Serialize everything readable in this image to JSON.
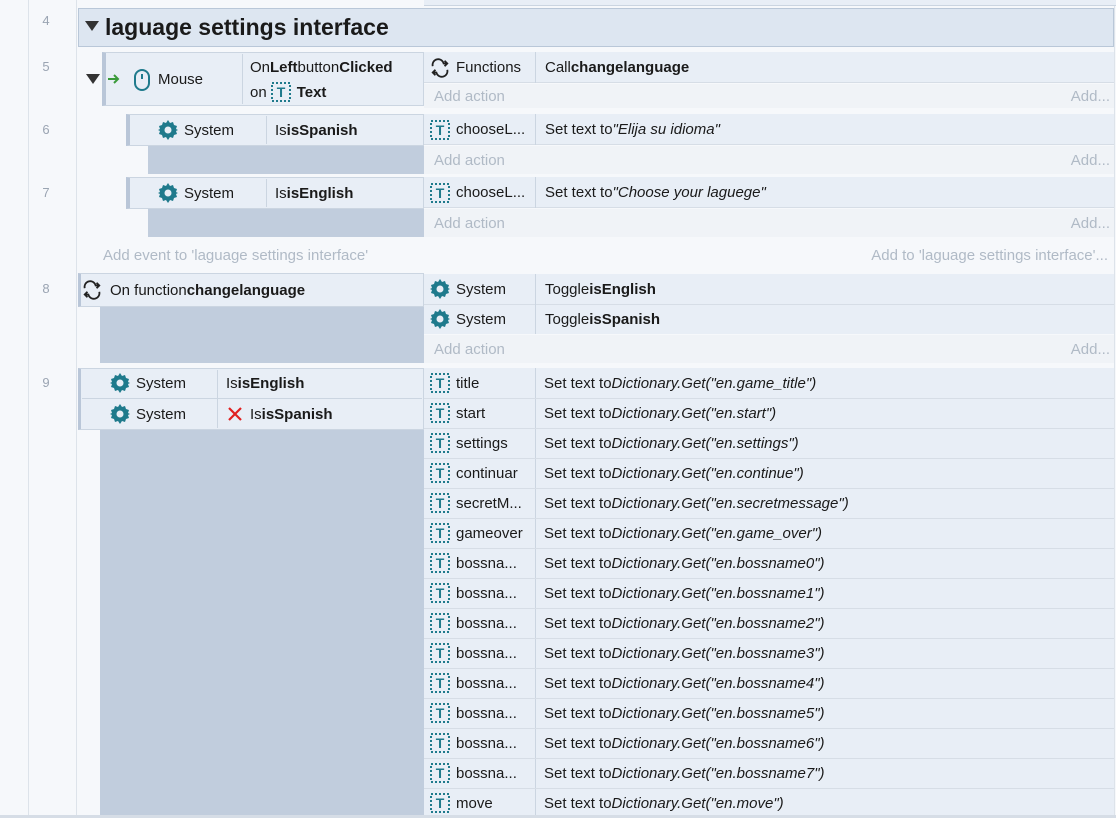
{
  "colors": {
    "teal": "#1f7a8c",
    "gutter": "#c1cddd",
    "cond": "#e8eef6",
    "green": "#3a9a3a",
    "red": "#e02020"
  },
  "line_numbers": [
    "4",
    "5",
    "6",
    "7",
    "8",
    "9"
  ],
  "group": {
    "title": "laguage settings interface",
    "expand_icon": "triangle-down-icon"
  },
  "event5": {
    "object": "Mouse",
    "icon": "mouse-icon",
    "cond_parts": [
      "On ",
      "Left",
      " button ",
      "Clicked"
    ],
    "cond_line2_prefix": "on ",
    "cond_line2_object": "Text",
    "action_object": "Functions",
    "action_text_prefix": "Call ",
    "action_text_bold": "changelanguage",
    "add_action": "Add action",
    "add_more": "Add..."
  },
  "event6": {
    "object": "System",
    "cond_prefix": "Is ",
    "cond_bold": "isSpanish",
    "action_object": "chooseL...",
    "action_prefix": "Set text to ",
    "action_italic": "\"Elija su idioma\"",
    "add_action": "Add action",
    "add_more": "Add..."
  },
  "event7": {
    "object": "System",
    "cond_prefix": "Is ",
    "cond_bold": "isEnglish",
    "action_object": "chooseL...",
    "action_prefix": "Set text to ",
    "action_italic": "\"Choose your laguege\"",
    "add_action": "Add action",
    "add_more": "Add..."
  },
  "group_footer": {
    "add_event": "Add event to 'laguage settings interface'",
    "add_to": "Add to 'laguage settings interface'..."
  },
  "event8": {
    "title_prefix": "On function ",
    "title_bold": "changelanguage",
    "actions": [
      {
        "object": "System",
        "prefix": "Toggle ",
        "bold": "isEnglish"
      },
      {
        "object": "System",
        "prefix": "Toggle ",
        "bold": "isSpanish"
      }
    ],
    "add_action": "Add action",
    "add_more": "Add..."
  },
  "event9": {
    "conditions": [
      {
        "object": "System",
        "prefix": "Is ",
        "bold": "isEnglish",
        "inverted": false
      },
      {
        "object": "System",
        "prefix": "Is ",
        "bold": "isSpanish",
        "inverted": true
      }
    ],
    "actions": [
      {
        "object": "title",
        "prefix": "Set text to ",
        "func": "Dictionary.Get(",
        "arg": "\"en.game_title\"",
        ")": ")"
      },
      {
        "object": "start",
        "prefix": "Set text to ",
        "func": "Dictionary.Get(",
        "arg": "\"en.start\"",
        ")": ")"
      },
      {
        "object": "settings",
        "prefix": "Set text to ",
        "func": "Dictionary.Get(",
        "arg": "\"en.settings\"",
        ")": ")"
      },
      {
        "object": "continuar",
        "prefix": "Set text to ",
        "func": "Dictionary.Get(",
        "arg": "\"en.continue\"",
        ")": ")"
      },
      {
        "object": "secretM...",
        "prefix": "Set text to ",
        "func": "Dictionary.Get(",
        "arg": "\"en.secretmessage\"",
        ")": ")"
      },
      {
        "object": "gameover",
        "prefix": "Set text to ",
        "func": "Dictionary.Get(",
        "arg": "\"en.game_over\"",
        ")": ")"
      },
      {
        "object": "bossna...",
        "prefix": "Set text to ",
        "func": "Dictionary.Get(",
        "arg": "\"en.bossname0\"",
        ")": ")"
      },
      {
        "object": "bossna...",
        "prefix": "Set text to ",
        "func": "Dictionary.Get(",
        "arg": "\"en.bossname1\"",
        ")": ")"
      },
      {
        "object": "bossna...",
        "prefix": "Set text to ",
        "func": "Dictionary.Get(",
        "arg": "\"en.bossname2\"",
        ")": ")"
      },
      {
        "object": "bossna...",
        "prefix": "Set text to ",
        "func": "Dictionary.Get(",
        "arg": "\"en.bossname3\"",
        ")": ")"
      },
      {
        "object": "bossna...",
        "prefix": "Set text to ",
        "func": "Dictionary.Get(",
        "arg": "\"en.bossname4\"",
        ")": ")"
      },
      {
        "object": "bossna...",
        "prefix": "Set text to ",
        "func": "Dictionary.Get(",
        "arg": "\"en.bossname5\"",
        ")": ")"
      },
      {
        "object": "bossna...",
        "prefix": "Set text to ",
        "func": "Dictionary.Get(",
        "arg": "\"en.bossname6\"",
        ")": ")"
      },
      {
        "object": "bossna...",
        "prefix": "Set text to ",
        "func": "Dictionary.Get(",
        "arg": "\"en.bossname7\"",
        ")": ")"
      },
      {
        "object": "move",
        "prefix": "Set text to ",
        "func": "Dictionary.Get(",
        "arg": "\"en.move\"",
        ")": ")"
      }
    ]
  }
}
